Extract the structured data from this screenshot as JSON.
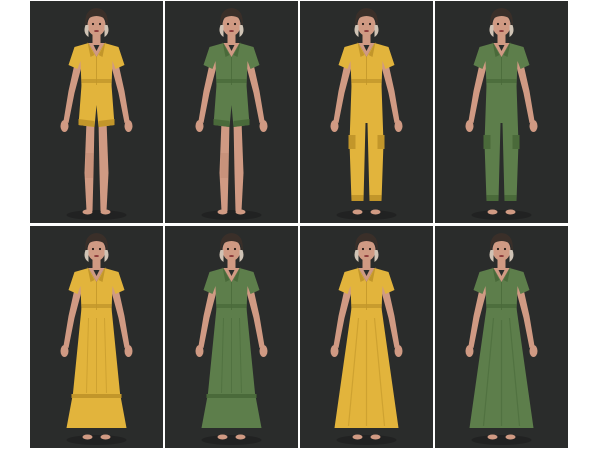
{
  "grid": {
    "rows": 2,
    "cols": 4
  },
  "colors": {
    "background": "#2a2c2b",
    "border": "#ffffff",
    "skin": "#d09a83",
    "skin_shade": "#b07a63",
    "hair_dark": "#3a2f29",
    "hair_light": "#cfc3b5",
    "mustard": "#e2b43c",
    "mustard_shade": "#c2962a",
    "sage": "#5d7e4b",
    "sage_shade": "#4a6a3a"
  },
  "panels": [
    {
      "outfit": "shirt-and-shorts",
      "color": "mustard",
      "icon": "person-figure-icon"
    },
    {
      "outfit": "shirt-and-shorts",
      "color": "sage",
      "icon": "person-figure-icon"
    },
    {
      "outfit": "shirt-and-cargo-pants",
      "color": "mustard",
      "icon": "person-figure-icon"
    },
    {
      "outfit": "shirt-and-cargo-pants",
      "color": "sage",
      "icon": "person-figure-icon"
    },
    {
      "outfit": "shirt-and-tiered-maxi-skirt",
      "color": "mustard",
      "icon": "person-figure-icon"
    },
    {
      "outfit": "shirt-and-tiered-maxi-skirt",
      "color": "sage",
      "icon": "person-figure-icon"
    },
    {
      "outfit": "shirt-and-flared-maxi-skirt",
      "color": "mustard",
      "icon": "person-figure-icon"
    },
    {
      "outfit": "shirt-and-flared-maxi-skirt",
      "color": "sage",
      "icon": "person-figure-icon"
    }
  ]
}
